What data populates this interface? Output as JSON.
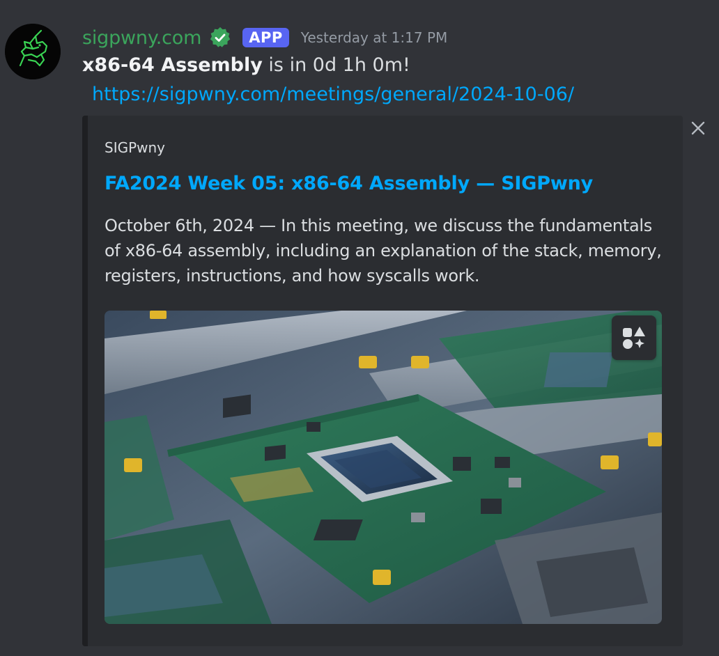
{
  "message": {
    "author": {
      "username": "sigpwny.com",
      "bot_tag": "APP",
      "timestamp": "Yesterday at 1:17 PM",
      "avatar_icon": "unicorn-logo-icon"
    },
    "content": {
      "bold_text": "x86-64 Assembly",
      "rest_text": " is in 0d 1h 0m!"
    },
    "link": "https://sigpwny.com/meetings/general/2024-10-06/"
  },
  "embed": {
    "provider": "SIGPwny",
    "title": "FA2024 Week 05: x86-64 Assembly — SIGPwny",
    "description": "October 6th, 2024 — In this meeting, we discuss the fundamentals of x86-64 assembly, including an explanation of the stack, memory, registers, instructions, and how syscalls work.",
    "image_alt": "circuit boards on assembly line",
    "close_icon": "close-icon",
    "image_action_icon": "apps-icon"
  },
  "colors": {
    "background": "#313338",
    "username": "#3ba55c",
    "link": "#00a8fc",
    "badge": "#5865f2",
    "embed_bg": "#2b2d31"
  }
}
